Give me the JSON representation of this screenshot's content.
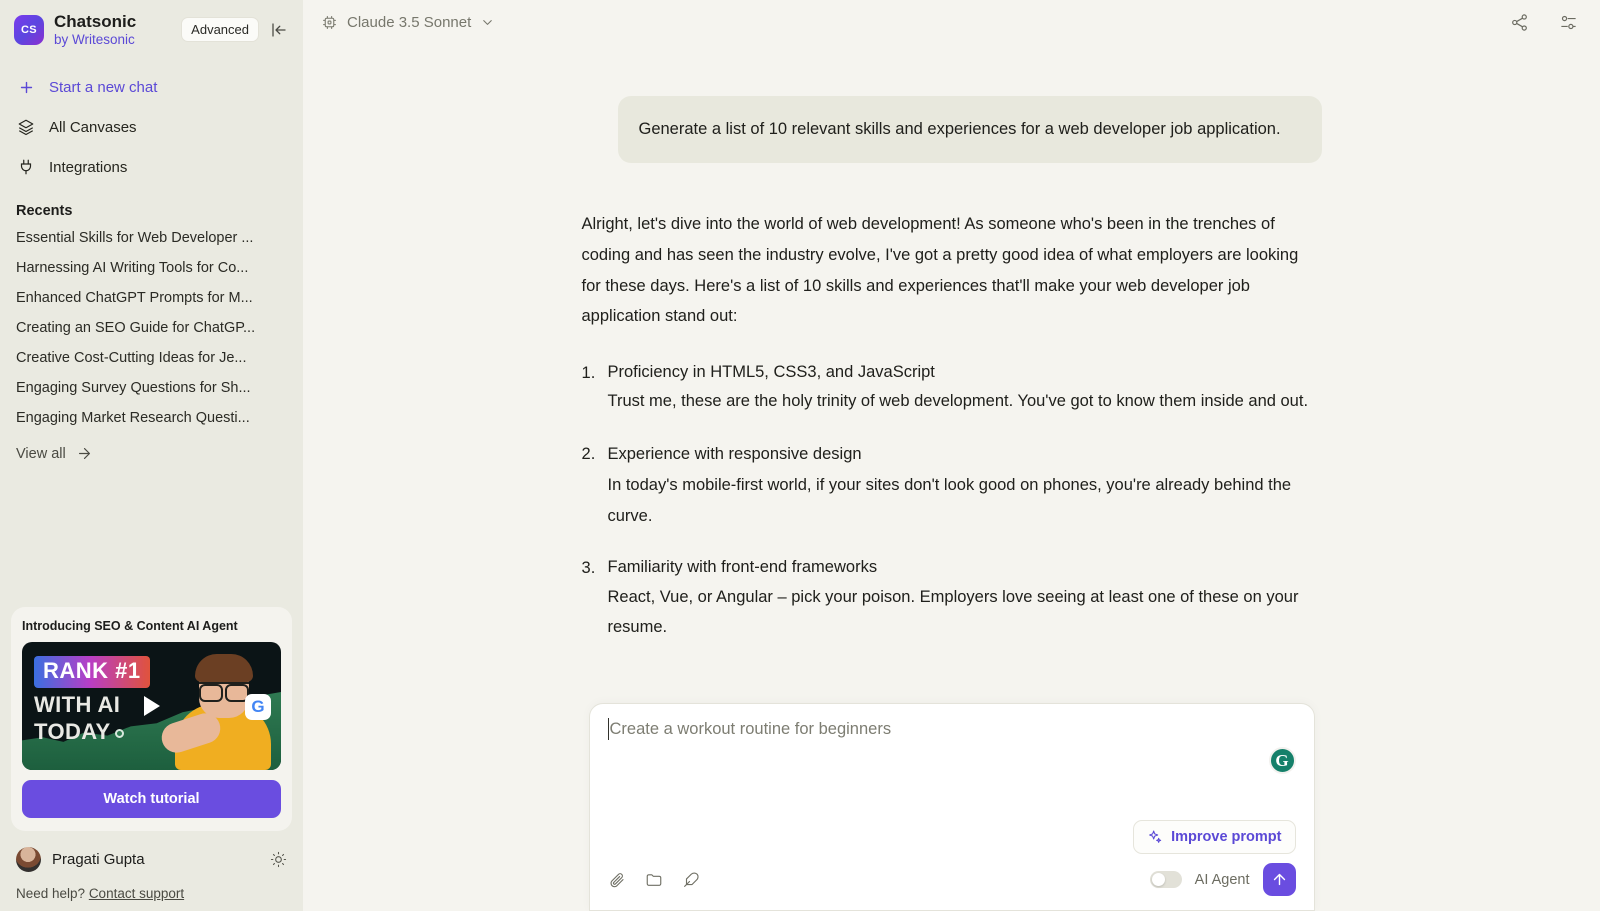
{
  "sidebar": {
    "brand": {
      "name": "Chatsonic",
      "subtitle": "by Writesonic",
      "logo_text": "CS"
    },
    "advanced_chip": "Advanced",
    "collapse_icon": "collapse-panel-icon",
    "nav": [
      {
        "label": "Start a new chat",
        "icon": "plus-icon"
      },
      {
        "label": "All Canvases",
        "icon": "layers-icon"
      },
      {
        "label": "Integrations",
        "icon": "plug-icon"
      }
    ],
    "recents_title": "Recents",
    "recents": [
      "Essential Skills for Web Developer ...",
      "Harnessing AI Writing Tools for Co...",
      "Enhanced ChatGPT Prompts for M...",
      "Creating an SEO Guide for ChatGP...",
      "Creative Cost-Cutting Ideas for Je...",
      "Engaging Survey Questions for Sh...",
      "Engaging Market Research Questi..."
    ],
    "view_all": "View all",
    "promo": {
      "title": "Introducing SEO & Content AI Agent",
      "thumb_line1": "RANK #1",
      "thumb_line2": "WITH AI",
      "thumb_line3": "TODAY",
      "thumb_google_glyph": "G",
      "button": "Watch tutorial"
    },
    "user": {
      "name": "Pragati Gupta",
      "theme_icon": "sun-icon"
    },
    "help": {
      "prefix": "Need help? ",
      "link": "Contact support"
    }
  },
  "topbar": {
    "model": "Claude 3.5 Sonnet",
    "model_icon": "chip-icon",
    "chevron": "chevron-down-icon",
    "share_icon": "share-icon",
    "settings_icon": "sliders-icon"
  },
  "conversation": {
    "user_message": "Generate a list of 10 relevant skills and experiences for a web developer job application.",
    "assistant_intro": "Alright, let's dive into the world of web development! As someone who's been in the trenches of coding and has seen the industry evolve, I've got a pretty good idea of what employers are looking for these days. Here's a list of 10 skills and experiences that'll make your web developer job application stand out:",
    "items": [
      {
        "title": "Proficiency in HTML5, CSS3, and JavaScript",
        "body": "Trust me, these are the holy trinity of web development. You've got to know them inside and out.",
        "title_on_new_line": true
      },
      {
        "title": "Experience with responsive design",
        "body": "In today's mobile-first world, if your sites don't look good on phones, you're already behind the curve.",
        "title_on_new_line": false
      },
      {
        "title": "Familiarity with front-end frameworks",
        "body": "React, Vue, or Angular – pick your poison. Employers love seeing at least one of these on your resume.",
        "title_on_new_line": true
      }
    ]
  },
  "composer": {
    "placeholder": "Create a workout routine for beginners",
    "grammarly_glyph": "G",
    "improve_prompt": "Improve prompt",
    "improve_icon": "sparkles-icon",
    "attach_icon": "paperclip-icon",
    "folder_icon": "folder-icon",
    "feather_icon": "feather-icon",
    "agent_label": "AI Agent",
    "agent_enabled": false,
    "send_icon": "arrow-up-icon"
  },
  "colors": {
    "sidebar_bg": "#eaeae1",
    "main_bg": "#f5f4ef",
    "bubble_bg": "#e8e8dd",
    "accent": "#5b49d6",
    "button_purple": "#6a4de0",
    "grammarly_green": "#15806a"
  }
}
